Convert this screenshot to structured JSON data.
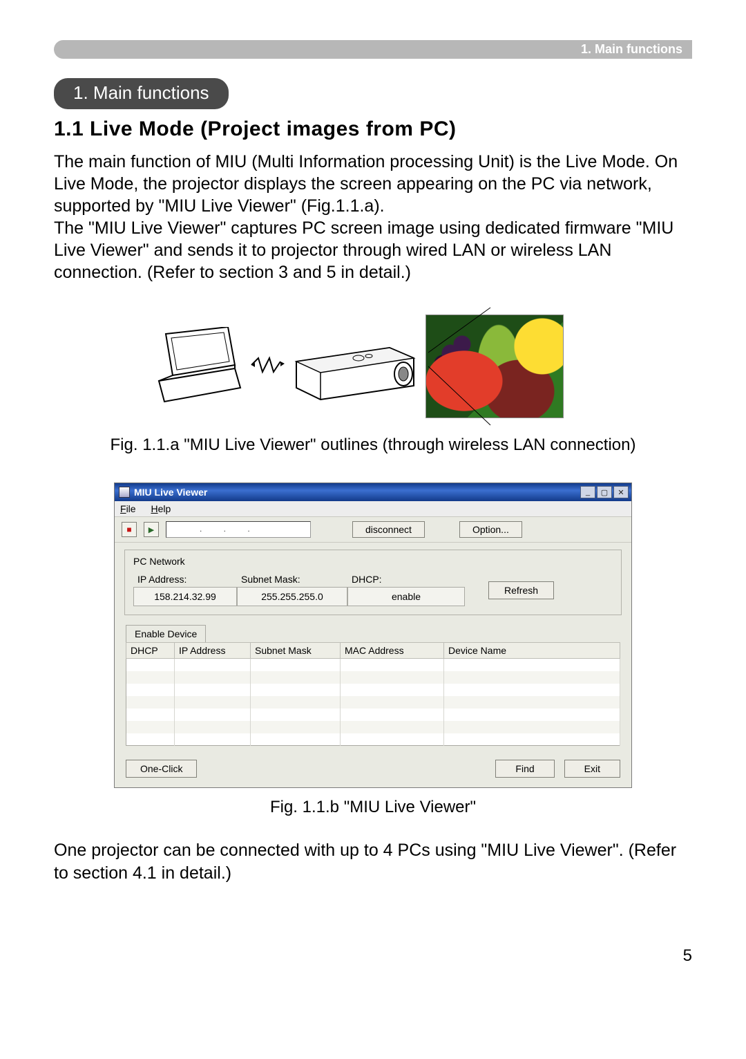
{
  "header_right": "1. Main functions",
  "pill_title": "1. Main functions",
  "section_title": "1.1 Live Mode (Project images from PC)",
  "paragraph1": "The main function of MIU (Multi Information processing Unit) is the Live Mode. On Live Mode, the projector displays the screen appearing on the PC via network, supported by \"MIU Live Viewer\" (Fig.1.1.a).\nThe \"MIU Live Viewer\" captures PC screen image using dedicated firmware \"MIU Live Viewer\" and sends it to projector through wired LAN or wireless LAN connection. (Refer to section 3 and 5 in detail.)",
  "fig_a_caption": "Fig. 1.1.a \"MIU Live Viewer\" outlines (through wireless LAN connection)",
  "miu_window": {
    "title": "MIU Live Viewer",
    "menu": {
      "file": "File",
      "help": "Help"
    },
    "toolbar": {
      "ip_placeholder": ". . .",
      "disconnect": "disconnect",
      "option": "Option..."
    },
    "pc_network": {
      "legend": "PC Network",
      "ip_label": "IP Address:",
      "ip_value": "158.214.32.99",
      "subnet_label": "Subnet Mask:",
      "subnet_value": "255.255.255.0",
      "dhcp_label": "DHCP:",
      "dhcp_value": "enable",
      "refresh": "Refresh"
    },
    "tab_label": "Enable Device",
    "table_headers": {
      "dhcp": "DHCP",
      "ip": "IP Address",
      "subnet": "Subnet Mask",
      "mac": "MAC Address",
      "name": "Device Name"
    },
    "buttons": {
      "one_click": "One-Click",
      "find": "Find",
      "exit": "Exit"
    }
  },
  "fig_b_caption": "Fig. 1.1.b \"MIU Live Viewer\"",
  "footer_text": "One projector can be connected with up to 4 PCs using \"MIU Live Viewer\". (Refer to section 4.1 in detail.)",
  "page_number": "5"
}
